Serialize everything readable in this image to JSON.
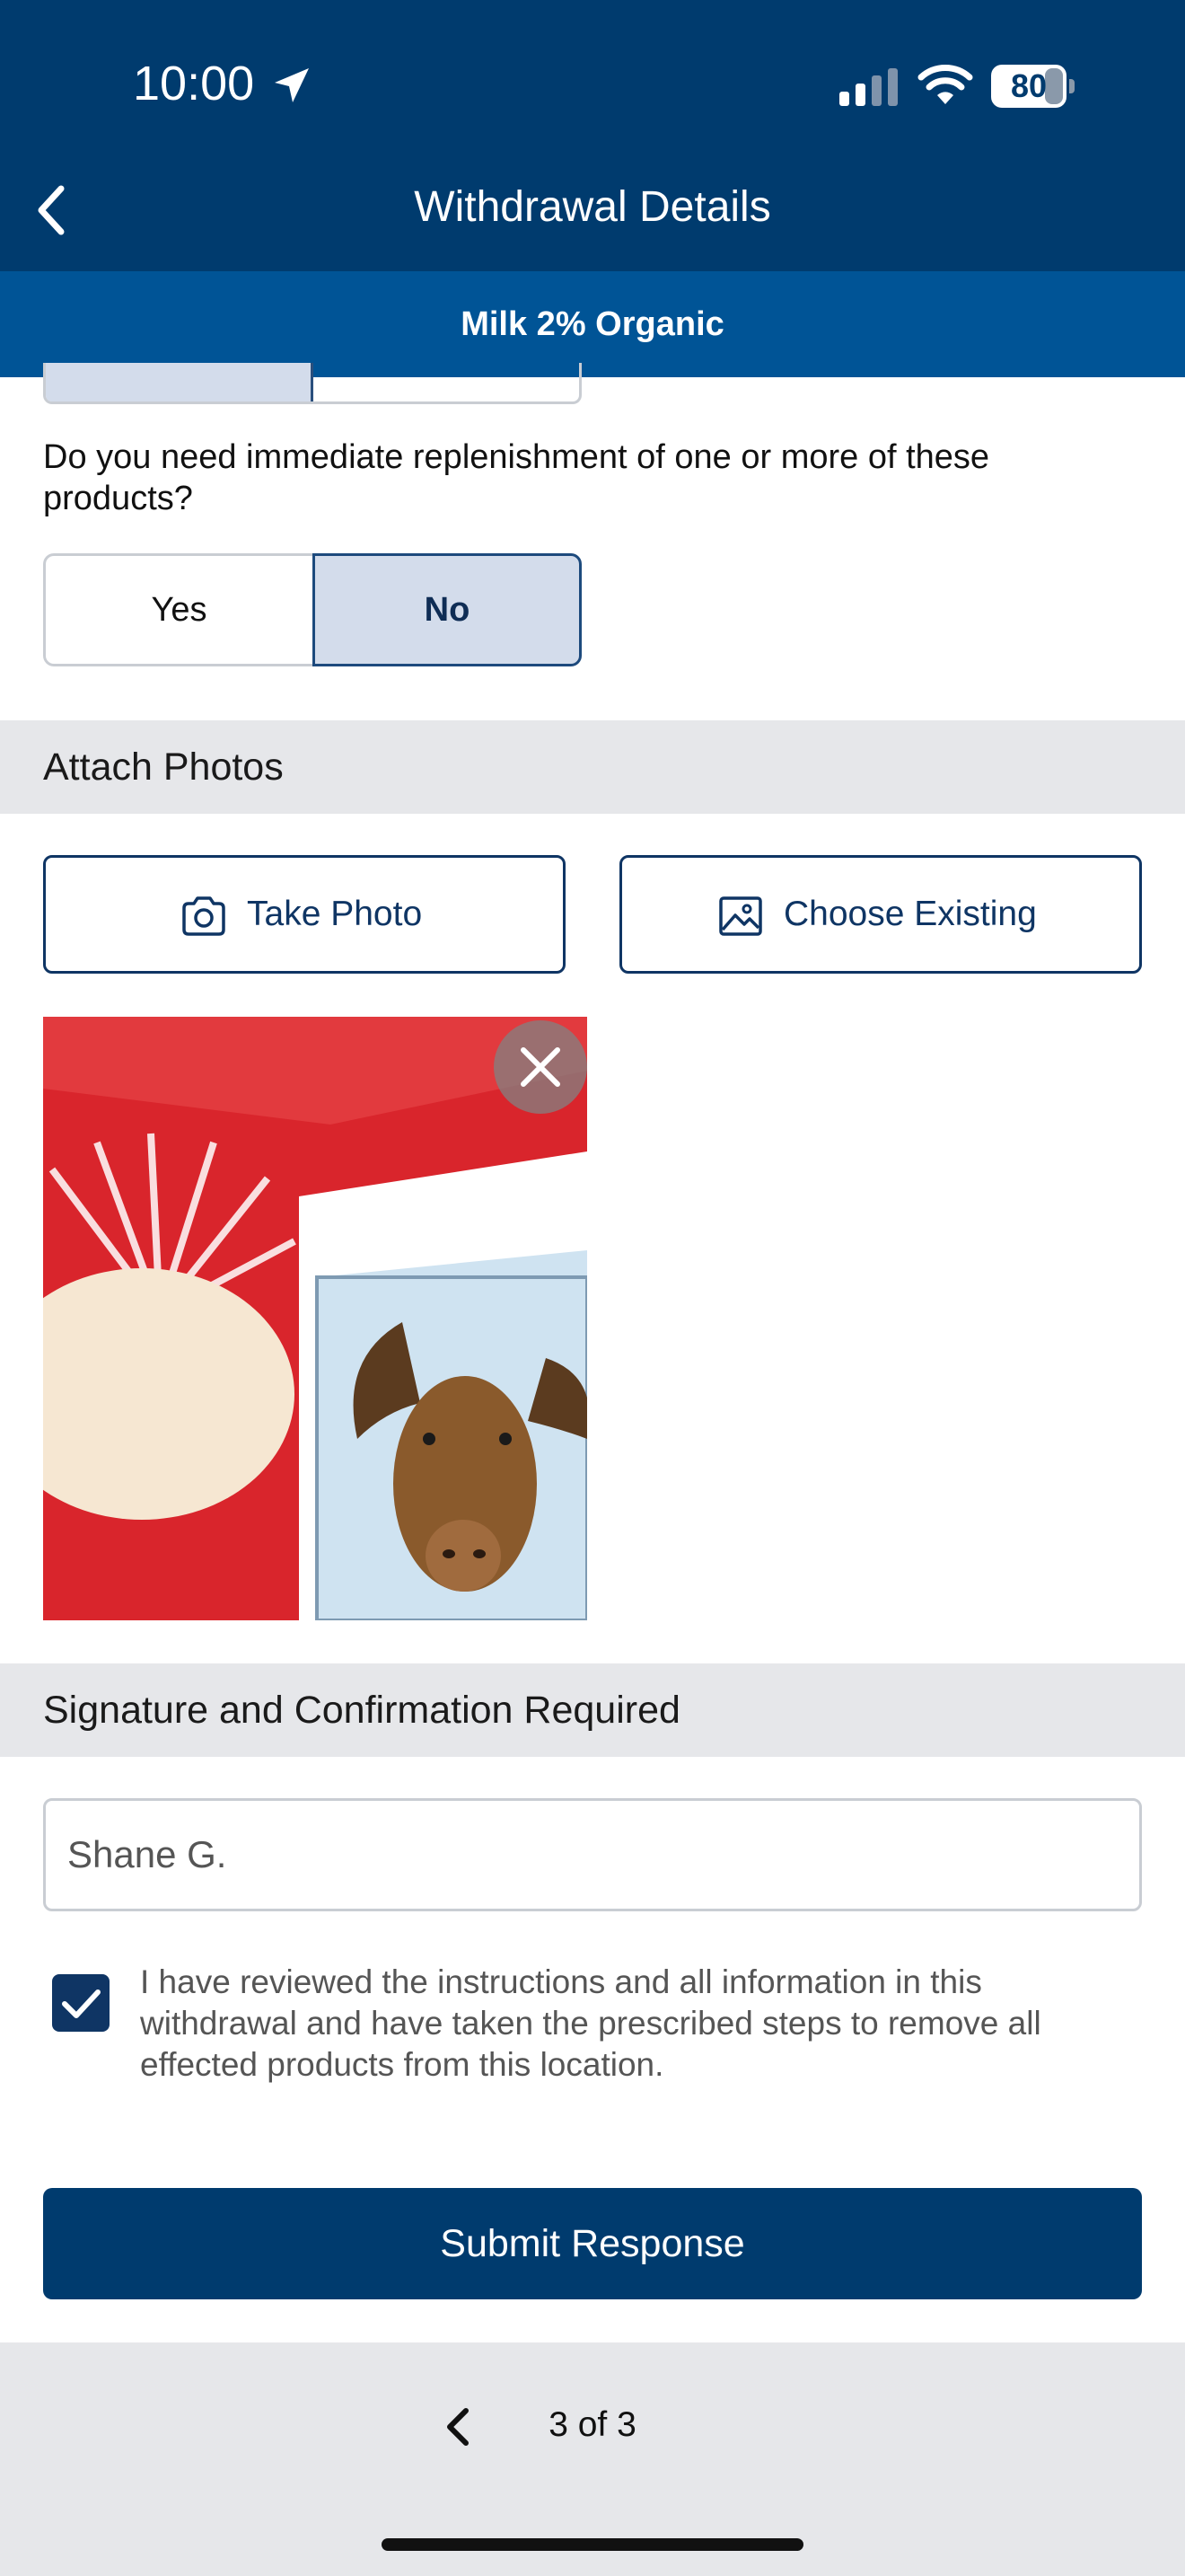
{
  "status_bar": {
    "time": "10:00",
    "battery_level": "80",
    "icons": [
      "location-arrow-icon",
      "cellular-signal-icon",
      "wifi-icon",
      "battery-icon"
    ]
  },
  "header": {
    "title": "Withdrawal Details",
    "back_icon": "chevron-left-icon"
  },
  "subheader": {
    "title": "Milk 2% Organic"
  },
  "replenishment": {
    "question": "Do you need immediate replenishment of one or more of these products?",
    "options": [
      "Yes",
      "No"
    ],
    "selected": "No"
  },
  "photos": {
    "section_title": "Attach Photos",
    "take_photo_label": "Take Photo",
    "choose_existing_label": "Choose Existing",
    "attached_count": 1
  },
  "signature": {
    "section_title": "Signature and Confirmation Required",
    "name_value": "Shane G.",
    "confirm_checked": true,
    "confirm_text": "I have reviewed the instructions and all information in this withdrawal and have taken the prescribed steps to remove all effected products from this location."
  },
  "actions": {
    "submit_label": "Submit Response"
  },
  "pagination": {
    "label": "3 of 3"
  },
  "colors": {
    "header": "#003b6e",
    "subheader": "#005496",
    "primary": "#0f3564",
    "selected_fill": "#d3dceb",
    "section_background": "#e6e7ea"
  }
}
